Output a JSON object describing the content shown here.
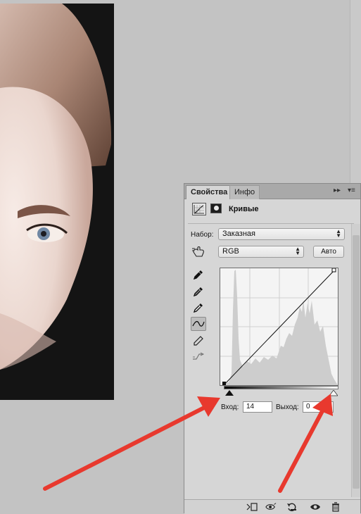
{
  "panel": {
    "tabs": [
      {
        "label": "Свойства",
        "active": true
      },
      {
        "label": "Инфо",
        "active": false
      }
    ],
    "tab_controls": {
      "collapse": "▸▸",
      "menu": "▾≡"
    },
    "title": "Кривые",
    "preset_label": "Набор:",
    "preset_value": "Заказная",
    "channel_value": "RGB",
    "auto_label": "Авто",
    "input_label": "Вход:",
    "input_value": "14",
    "output_label": "Выход:",
    "output_value": "0"
  },
  "tools": [
    "eyedropper-black-icon",
    "eyedropper-gray-icon",
    "eyedropper-white-icon",
    "curve-point-icon",
    "pencil-icon",
    "smooth-icon"
  ],
  "bottom_icons": [
    "clip-to-layer-icon",
    "view-previous-icon",
    "reset-icon",
    "visibility-eye-icon",
    "trash-icon"
  ],
  "colors": {
    "annotation_arrow": "#e8392e",
    "panel_bg": "#d6d6d6",
    "workspace_bg": "#c3c3c3"
  }
}
